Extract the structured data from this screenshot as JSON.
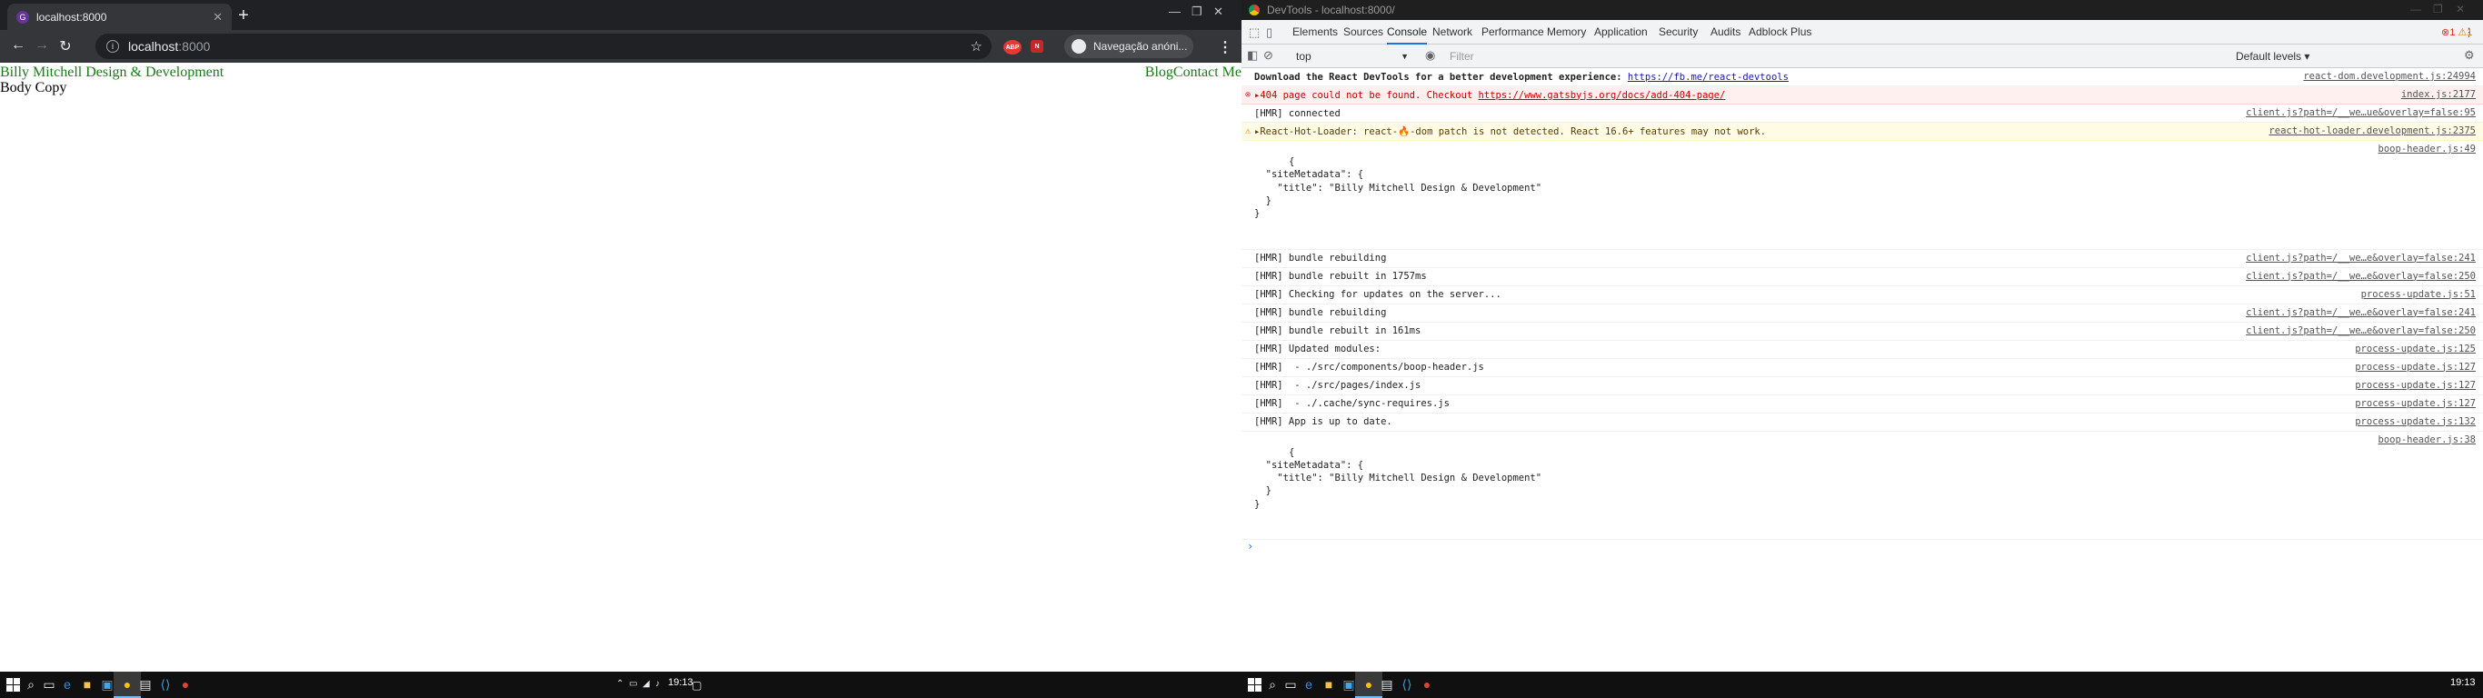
{
  "browser": {
    "tab_title": "localhost:8000",
    "tab_close": "✕",
    "new_tab": "+",
    "url_host": "localhost",
    "url_port": ":8000",
    "incognito_label": "Navegação anóni...",
    "ext1": "ABP",
    "ext2": "N"
  },
  "page": {
    "site_title": "Billy Mitchell Design & Development",
    "nav_links": "BlogContact Me",
    "body_copy": "Body Copy"
  },
  "devtools": {
    "window_title": "DevTools - localhost:8000/",
    "tabs": [
      "Elements",
      "Sources",
      "Console",
      "Network",
      "Performance",
      "Memory",
      "Application",
      "Security",
      "Audits",
      "Adblock Plus"
    ],
    "error_count": "1",
    "warning_count": "1",
    "context": "top",
    "filter_placeholder": "Filter",
    "levels": "Default levels",
    "rows": [
      {
        "type": "info",
        "msg": "Download the React DevTools for a better development experience: ",
        "link": "https://fb.me/react-devtools",
        "src": "react-dom.development.js:24994"
      },
      {
        "type": "error",
        "msg": "▸404 page could not be found. Checkout ",
        "link": "https://www.gatsbyjs.org/docs/add-404-page/",
        "src": "index.js:2177"
      },
      {
        "type": "log",
        "msg": "[HMR] connected",
        "src": "client.js?path=/__we…ue&overlay=false:95"
      },
      {
        "type": "warn",
        "msg": "▸React-Hot-Loader: react-🔥-dom patch is not detected. React 16.6+ features may not work.",
        "src": "react-hot-loader.development.js:2375"
      }
    ],
    "obj1": {
      "text": "{\n  \"siteMetadata\": {\n    \"title\": \"Billy Mitchell Design & Development\"\n  }\n}",
      "src": "boop-header.js:49"
    },
    "rows2": [
      {
        "msg": "[HMR] bundle rebuilding",
        "src": "client.js?path=/__we…e&overlay=false:241"
      },
      {
        "msg": "[HMR] bundle rebuilt in 1757ms",
        "src": "client.js?path=/__we…e&overlay=false:250"
      },
      {
        "msg": "[HMR] Checking for updates on the server...",
        "src": "process-update.js:51"
      },
      {
        "msg": "[HMR] bundle rebuilding",
        "src": "client.js?path=/__we…e&overlay=false:241"
      },
      {
        "msg": "[HMR] bundle rebuilt in 161ms",
        "src": "client.js?path=/__we…e&overlay=false:250"
      },
      {
        "msg": "[HMR] Updated modules:",
        "src": "process-update.js:125"
      },
      {
        "msg": "[HMR]  - ./src/components/boop-header.js",
        "src": "process-update.js:127"
      },
      {
        "msg": "[HMR]  - ./src/pages/index.js",
        "src": "process-update.js:127"
      },
      {
        "msg": "[HMR]  - ./.cache/sync-requires.js",
        "src": "process-update.js:127"
      },
      {
        "msg": "[HMR] App is up to date.",
        "src": "process-update.js:132"
      }
    ],
    "obj2": {
      "text": "{\n  \"siteMetadata\": {\n    \"title\": \"Billy Mitchell Design & Development\"\n  }\n}",
      "src": "boop-header.js:38"
    },
    "prompt": "›"
  },
  "taskbar": {
    "clock_left": "19:13",
    "clock_right": "19:13"
  }
}
